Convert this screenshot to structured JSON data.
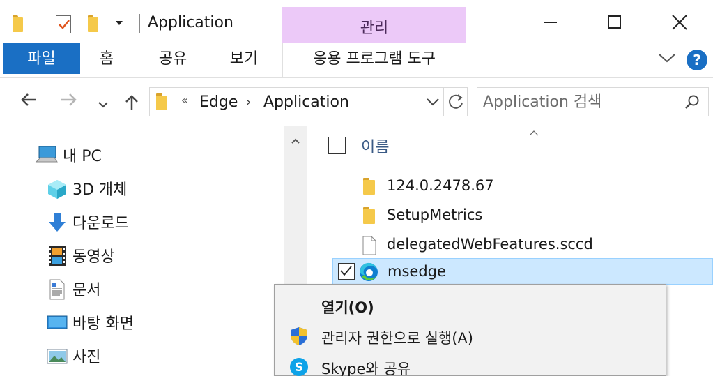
{
  "window": {
    "title": "Application",
    "contextual_group": "관리",
    "accent_color": "#1a6fc4",
    "contextual_color": "#ecc9f8"
  },
  "quick_access": {
    "icons": [
      "folder-icon",
      "properties-check-icon",
      "new-folder-icon",
      "customize-dropdown-icon"
    ]
  },
  "ribbon": {
    "tabs": [
      {
        "key": "file",
        "label": "파일",
        "active": true
      },
      {
        "key": "home",
        "label": "홈"
      },
      {
        "key": "share",
        "label": "공유"
      },
      {
        "key": "view",
        "label": "보기"
      },
      {
        "key": "apptools",
        "label": "응용 프로그램 도구"
      }
    ],
    "help_label": "?"
  },
  "address": {
    "overflow": "«",
    "crumbs": [
      "Edge",
      "Application"
    ],
    "separator": "›"
  },
  "search": {
    "placeholder": "Application 검색"
  },
  "nav": {
    "items": [
      {
        "label": "내 PC",
        "icon": "computer-icon"
      },
      {
        "label": "3D 개체",
        "icon": "3d-objects-icon"
      },
      {
        "label": "다운로드",
        "icon": "download-arrow-icon"
      },
      {
        "label": "동영상",
        "icon": "video-film-icon"
      },
      {
        "label": "문서",
        "icon": "document-icon"
      },
      {
        "label": "바탕 화면",
        "icon": "desktop-icon"
      },
      {
        "label": "사진",
        "icon": "pictures-icon"
      }
    ]
  },
  "content": {
    "column_name": "이름",
    "files": [
      {
        "name": "124.0.2478.67",
        "type": "folder",
        "icon": "folder-icon"
      },
      {
        "name": "SetupMetrics",
        "type": "folder",
        "icon": "folder-icon"
      },
      {
        "name": "delegatedWebFeatures.sccd",
        "type": "file",
        "icon": "file-icon"
      },
      {
        "name": "msedge",
        "type": "app",
        "icon": "edge-icon",
        "selected": true,
        "checked": true
      }
    ]
  },
  "context_menu": {
    "items": [
      {
        "label": "열기(O)",
        "bold": true
      },
      {
        "label": "관리자 권한으로 실행(A)",
        "icon": "uac-shield-icon"
      },
      {
        "label": "Skype와 공유",
        "icon": "skype-icon"
      }
    ]
  }
}
